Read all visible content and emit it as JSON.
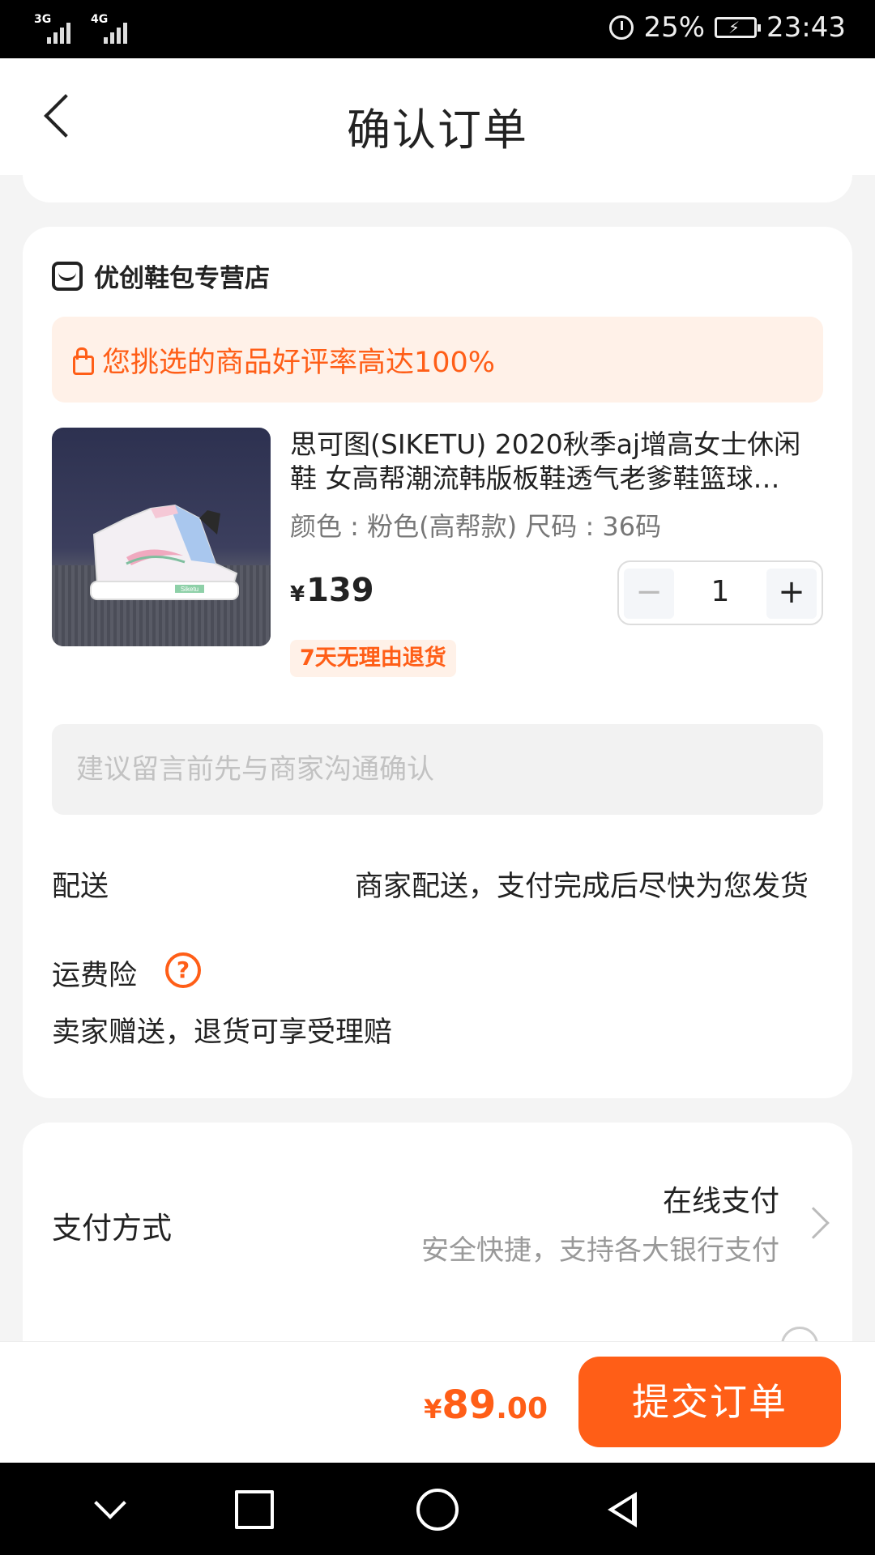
{
  "status_bar": {
    "signal1_label": "3G",
    "signal2_label": "4G",
    "battery_percent": "25%",
    "time": "23:43"
  },
  "header": {
    "title": "确认订单"
  },
  "shop": {
    "name": "优创鞋包专营店"
  },
  "banner": {
    "text": "您挑选的商品好评率高达100%"
  },
  "product": {
    "title_line1": "思可图(SIKETU) 2020秋季aj增高女士休闲",
    "title_line2": "鞋 女高帮潮流韩版板鞋透气老爹鞋篮球…",
    "spec": "颜色 : 粉色(高帮款)  尺码 : 36码",
    "currency": "¥",
    "price": "139",
    "quantity": "1",
    "minus_symbol": "−",
    "plus_symbol": "+",
    "return_tag": "7天无理由退货",
    "brand_mark": "Siketu"
  },
  "note": {
    "placeholder": "建议留言前先与商家沟通确认"
  },
  "shipping": {
    "label": "配送",
    "value": "商家配送，支付完成后尽快为您发货"
  },
  "insurance": {
    "label": "运费险",
    "help_symbol": "?",
    "desc": "卖家赠送，退货可享受理赔"
  },
  "payment": {
    "label": "支付方式",
    "value": "在线支付",
    "sub": "安全快捷，支持各大银行支付"
  },
  "footer": {
    "currency": "¥",
    "total_int": "89",
    "total_dec": ".00",
    "submit_label": "提交订单"
  },
  "colors": {
    "accent": "#ff5e17",
    "banner_bg": "#fff1e8"
  }
}
